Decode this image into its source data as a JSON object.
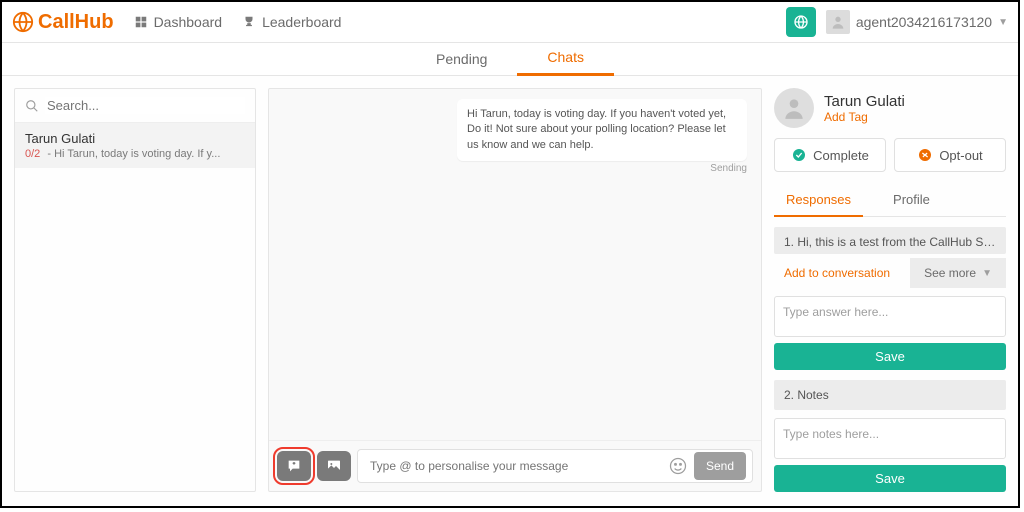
{
  "brand": "CallHub",
  "top_nav": {
    "dashboard": "Dashboard",
    "leaderboard": "Leaderboard"
  },
  "user": "agent2034216173120",
  "tabs": {
    "pending": "Pending",
    "chats": "Chats"
  },
  "search_placeholder": "Search...",
  "conversation": {
    "name": "Tarun Gulati",
    "count": "0/2",
    "preview": " - Hi Tarun, today is voting day. If y..."
  },
  "message": {
    "text": "Hi Tarun, today is voting day. If you haven't voted yet, Do it! Not sure about your polling location? Please let us know and we can help.",
    "status": "Sending"
  },
  "composer_placeholder": "Type @ to personalise your message",
  "send_label": "Send",
  "contact": {
    "name": "Tarun Gulati",
    "add_tag": "Add Tag"
  },
  "actions": {
    "complete": "Complete",
    "optout": "Opt-out"
  },
  "right_tabs": {
    "responses": "Responses",
    "profile": "Profile"
  },
  "script_line": "1. Hi, this is a test from the CallHub Support team. …",
  "add_to_conv": "Add to conversation",
  "see_more": "See more",
  "answer_placeholder": "Type answer here...",
  "save_label": "Save",
  "notes_label": "2. Notes",
  "notes_placeholder": "Type notes here..."
}
